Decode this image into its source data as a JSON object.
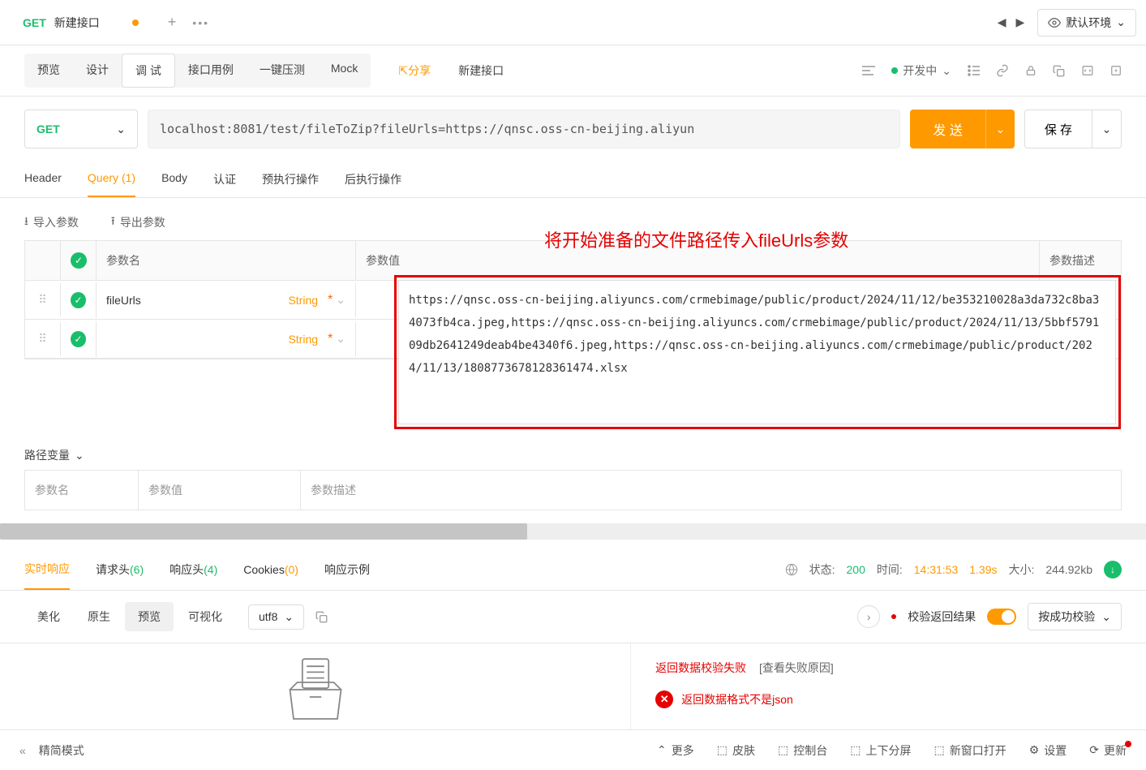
{
  "tabs": {
    "method": "GET",
    "name": "新建接口",
    "add": "+",
    "more": "•••"
  },
  "topRight": {
    "env": "默认环境"
  },
  "actions": {
    "preview": "预览",
    "design": "设计",
    "debug": "调 试",
    "cases": "接口用例",
    "stress": "一键压测",
    "mock": "Mock",
    "share": "分享",
    "newApi": "新建接口",
    "devStatus": "开发中"
  },
  "urlBar": {
    "method": "GET",
    "url": "localhost:8081/test/fileToZip?fileUrls=https://qnsc.oss-cn-beijing.aliyun",
    "send": "发 送",
    "save": "保 存"
  },
  "paramTabs": {
    "header": "Header",
    "query": "Query",
    "queryCount": "(1)",
    "body": "Body",
    "auth": "认证",
    "preExec": "预执行操作",
    "postExec": "后执行操作"
  },
  "importExport": {
    "import": "导入参数",
    "export": "导出参数"
  },
  "paramsTable": {
    "colName": "参数名",
    "colValue": "参数值",
    "colDesc": "参数描述",
    "annotation": "将开始准备的文件路径传入fileUrls参数",
    "rows": [
      {
        "name": "fileUrls",
        "type": "String"
      },
      {
        "name": "",
        "type": "String"
      }
    ],
    "valueText": "https://qnsc.oss-cn-beijing.aliyuncs.com/crmebimage/public/product/2024/11/12/be353210028a3da732c8ba34073fb4ca.jpeg,https://qnsc.oss-cn-beijing.aliyuncs.com/crmebimage/public/product/2024/11/13/5bbf579109db2641249deab4be4340f6.jpeg,https://qnsc.oss-cn-beijing.aliyuncs.com/crmebimage/public/product/2024/11/13/1808773678128361474.xlsx"
  },
  "pathVars": {
    "label": "路径变量",
    "colName": "参数名",
    "colValue": "参数值",
    "colDesc": "参数描述"
  },
  "respTabs": {
    "realtime": "实时响应",
    "reqHead": "请求头",
    "reqHeadCount": "(6)",
    "respHead": "响应头",
    "respHeadCount": "(4)",
    "cookies": "Cookies",
    "cookiesCount": "(0)",
    "respExample": "响应示例"
  },
  "respMeta": {
    "statusLabel": "状态:",
    "statusCode": "200",
    "timeLabel": "时间:",
    "timeValue": "14:31:53",
    "duration": "1.39s",
    "sizeLabel": "大小:",
    "sizeValue": "244.92kb"
  },
  "viewTabs": {
    "beautify": "美化",
    "raw": "原生",
    "preview": "预览",
    "visual": "可视化",
    "encoding": "utf8"
  },
  "validation": {
    "checkLabel": "校验返回结果",
    "bySuccess": "按成功校验",
    "failTitle": "返回数据校验失败",
    "failReason": "[查看失败原因]",
    "errMsg": "返回数据格式不是json"
  },
  "bottomBar": {
    "mode": "精简模式",
    "more": "更多",
    "skin": "皮肤",
    "console": "控制台",
    "split": "上下分屏",
    "newWin": "新窗口打开",
    "settings": "设置",
    "update": "更新"
  },
  "icons": {
    "share": "⤴",
    "caret": "⌄"
  }
}
